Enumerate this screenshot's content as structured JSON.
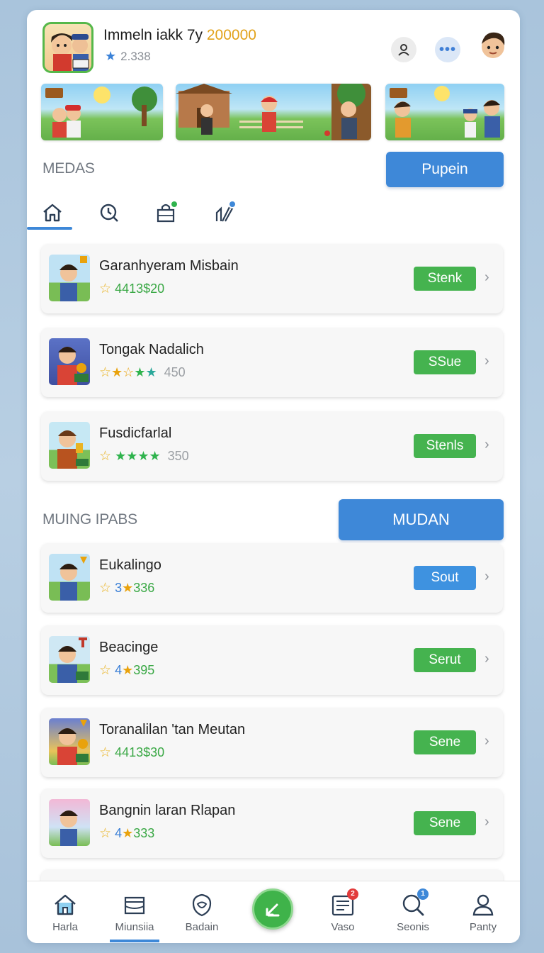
{
  "header": {
    "title_main": "Immeln iakk 7y ",
    "title_accent": "200000",
    "rating": "2.338",
    "colors": {
      "accent": "#3e88d8",
      "gold": "#e2a21a",
      "green": "#45b34f"
    }
  },
  "section1": {
    "title": "MEDAS",
    "button_label": "Pupein"
  },
  "tabs": [
    {
      "icon": "home-icon"
    },
    {
      "icon": "search-clock-icon"
    },
    {
      "icon": "bag-icon",
      "badge_color": "#2fb34d"
    },
    {
      "icon": "tools-icon",
      "badge_color": "#3e88d8"
    }
  ],
  "list1": [
    {
      "name": "Garanhyeram Misbain",
      "rating": "4413$20",
      "action": "Stenk"
    },
    {
      "name": "Tongak Nadalich",
      "rating": "450",
      "action": "SSue"
    },
    {
      "name": "Fusdicfarlal",
      "rating": "350",
      "action": "Stenls"
    }
  ],
  "section2": {
    "title": "MUING IPABS",
    "button_label": "MUDAN"
  },
  "list2": [
    {
      "name": "Eukalingo",
      "rating_a": "3",
      "rating_b": "336",
      "action": "Sout"
    },
    {
      "name": "Beacinge",
      "rating_a": "4",
      "rating_b": "395",
      "action": "Serut"
    },
    {
      "name": "Toranalilan 'tan  Meutan",
      "rating": "4413$30",
      "action": "Sene"
    },
    {
      "name": "Bangnin laran Rlapan",
      "rating_a": "4",
      "rating_b": "333",
      "action": "Sene"
    }
  ],
  "bottom_nav": [
    {
      "label": "Harla",
      "icon": "home-icon"
    },
    {
      "label": "Miunsiia",
      "icon": "box-icon"
    },
    {
      "label": "Badain",
      "icon": "shield-icon"
    },
    {
      "label": "",
      "icon": "edit-icon"
    },
    {
      "label": "Vaso",
      "icon": "news-icon",
      "badge": "2"
    },
    {
      "label": "Seonis",
      "icon": "search-icon",
      "badge": "1"
    },
    {
      "label": "Panty",
      "icon": "person-icon"
    }
  ]
}
